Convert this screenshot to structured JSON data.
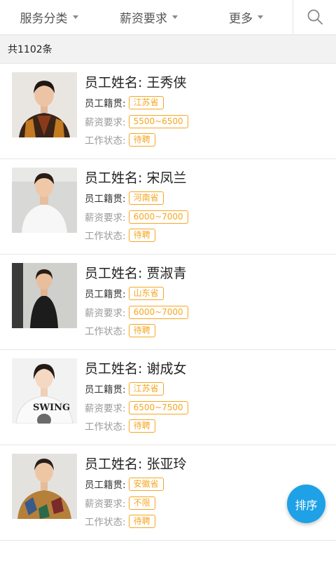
{
  "filters": [
    {
      "label": "服务分类"
    },
    {
      "label": "薪资要求"
    },
    {
      "label": "更多"
    }
  ],
  "search_icon": "search-icon",
  "count_text": "共1102条",
  "employees": [
    {
      "name": "员工姓名: 王秀侠",
      "origin_label": "员工籍贯:",
      "origin": "江苏省",
      "salary_label": "薪资要求:",
      "salary": "5500~6500",
      "status_label": "工作状态:",
      "status": "待聘"
    },
    {
      "name": "员工姓名: 宋凤兰",
      "origin_label": "员工籍贯:",
      "origin": "河南省",
      "salary_label": "薪资要求:",
      "salary": "6000~7000",
      "status_label": "工作状态:",
      "status": "待聘"
    },
    {
      "name": "员工姓名: 贾淑青",
      "origin_label": "员工籍贯:",
      "origin": "山东省",
      "salary_label": "薪资要求:",
      "salary": "6000~7000",
      "status_label": "工作状态:",
      "status": "待聘"
    },
    {
      "name": "员工姓名: 谢成女",
      "origin_label": "员工籍贯:",
      "origin": "江苏省",
      "salary_label": "薪资要求:",
      "salary": "6500~7500",
      "status_label": "工作状态:",
      "status": "待聘"
    },
    {
      "name": "员工姓名: 张亚玲",
      "origin_label": "员工籍贯:",
      "origin": "安徽省",
      "salary_label": "薪资要求:",
      "salary": "不限",
      "status_label": "工作状态:",
      "status": "待聘"
    }
  ],
  "photo_shirt_text": "SWING",
  "sort_button": "排序",
  "colors": {
    "accent": "#1ea1e6",
    "tag": "#f5a623"
  }
}
